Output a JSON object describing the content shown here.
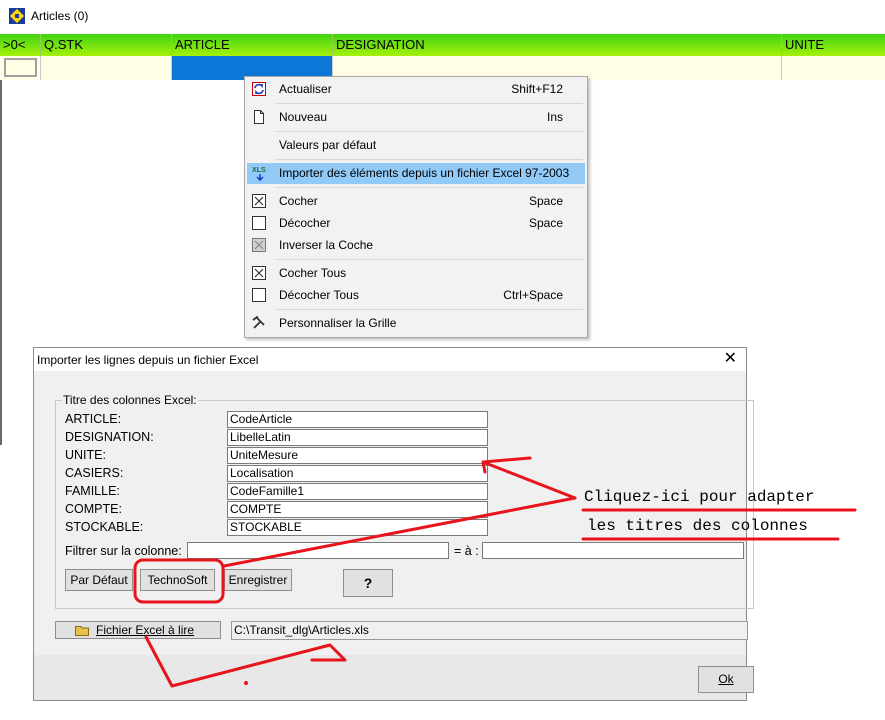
{
  "window": {
    "title": "Articles (0)"
  },
  "grid": {
    "columns": [
      ">0<",
      "Q.STK",
      "ARTICLE",
      "DESIGNATION",
      "UNITE"
    ]
  },
  "context_menu": {
    "items": [
      {
        "label": "Actualiser",
        "shortcut": "Shift+F12",
        "icon": "refresh-icon"
      },
      {
        "label": "Nouveau",
        "shortcut": "Ins",
        "icon": "new-document-icon"
      },
      {
        "label": "Valeurs par défaut",
        "shortcut": "",
        "icon": ""
      },
      {
        "label": "Importer des éléments depuis un fichier Excel 97-2003",
        "shortcut": "",
        "icon": "xls-import-icon"
      },
      {
        "label": "Cocher",
        "shortcut": "Space",
        "icon": "checked-box-icon"
      },
      {
        "label": "Décocher",
        "shortcut": "Space",
        "icon": "unchecked-box-icon"
      },
      {
        "label": "Inverser la Coche",
        "shortcut": "",
        "icon": "toggle-check-icon"
      },
      {
        "label": "Cocher Tous",
        "shortcut": "",
        "icon": "checked-box-icon"
      },
      {
        "label": "Décocher Tous",
        "shortcut": "Ctrl+Space",
        "icon": "unchecked-box-icon"
      },
      {
        "label": "Personnaliser la Grille",
        "shortcut": "",
        "icon": "tools-icon"
      }
    ]
  },
  "dialog": {
    "title": "Importer les lignes depuis un fichier Excel",
    "group_title": "Titre des colonnes Excel:",
    "fields": [
      {
        "label": "ARTICLE:",
        "value": "CodeArticle"
      },
      {
        "label": "DESIGNATION:",
        "value": "LibelleLatin"
      },
      {
        "label": "UNITE:",
        "value": "UniteMesure"
      },
      {
        "label": "CASIERS:",
        "value": "Localisation"
      },
      {
        "label": "FAMILLE:",
        "value": "CodeFamille1"
      },
      {
        "label": "COMPTE:",
        "value": "COMPTE"
      },
      {
        "label": "STOCKABLE:",
        "value": "STOCKABLE"
      }
    ],
    "filter_label": "Filtrer sur la colonne:",
    "filter_from": "",
    "filter_to_label": "= à :",
    "filter_to": "",
    "buttons": {
      "par_defaut": "Par Défaut",
      "technosoft": "TechnoSoft",
      "enregistrer": "Enregistrer",
      "help": "?",
      "file": "Fichier Excel à lire",
      "ok": "Ok"
    },
    "file_path": "C:\\Transit_dlg\\Articles.xls"
  },
  "annotation": {
    "line1": "Cliquez-ici pour adapter",
    "line2": "les titres des colonnes",
    "color": "#e8141b"
  },
  "colors": {
    "header_green": "#5fdc12",
    "menu_highlight": "#91c9f7",
    "selected_cell": "#0b78d7"
  }
}
